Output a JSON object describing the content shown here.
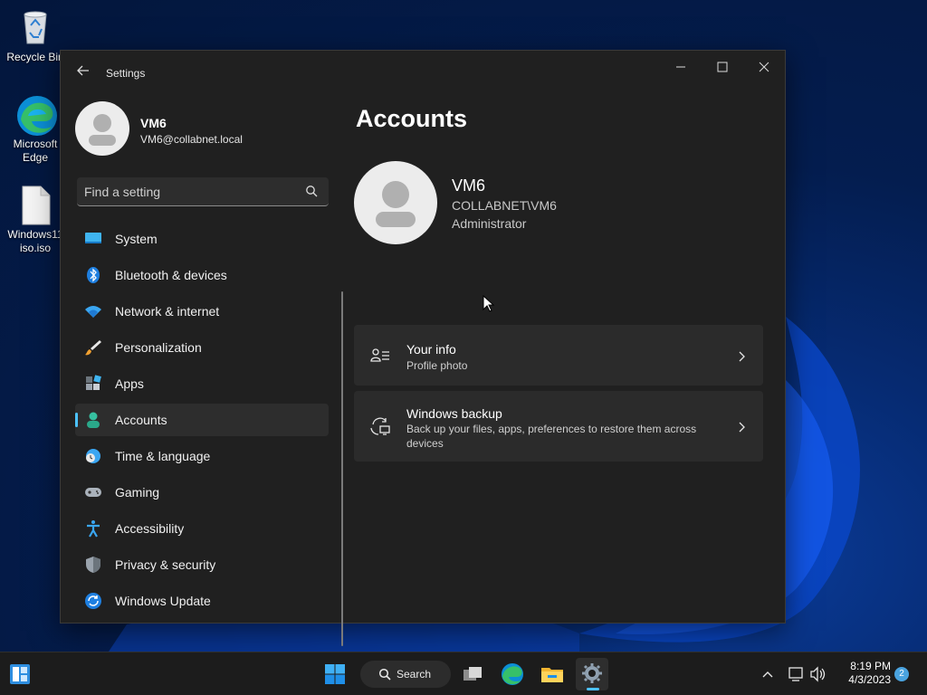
{
  "desktop": {
    "icons": [
      {
        "label": "Recycle Bin"
      },
      {
        "label": "Microsoft Edge"
      },
      {
        "label": "Windows11 iso.iso"
      }
    ]
  },
  "window": {
    "title": "Settings",
    "controls": {
      "minimize": "—",
      "maximize": "☐",
      "close": "✕"
    }
  },
  "profile": {
    "name": "VM6",
    "email": "VM6@collabnet.local"
  },
  "search": {
    "placeholder": "Find a setting"
  },
  "nav": {
    "items": [
      {
        "label": "System",
        "icon": "system-icon"
      },
      {
        "label": "Bluetooth & devices",
        "icon": "bluetooth-icon"
      },
      {
        "label": "Network & internet",
        "icon": "wifi-icon"
      },
      {
        "label": "Personalization",
        "icon": "brush-icon"
      },
      {
        "label": "Apps",
        "icon": "apps-icon"
      },
      {
        "label": "Accounts",
        "icon": "accounts-icon",
        "active": true
      },
      {
        "label": "Time & language",
        "icon": "time-language-icon"
      },
      {
        "label": "Gaming",
        "icon": "gamepad-icon"
      },
      {
        "label": "Accessibility",
        "icon": "accessibility-icon"
      },
      {
        "label": "Privacy & security",
        "icon": "shield-icon"
      },
      {
        "label": "Windows Update",
        "icon": "update-icon"
      }
    ]
  },
  "main": {
    "title": "Accounts",
    "account": {
      "name": "VM6",
      "domain": "COLLABNET\\VM6",
      "role": "Administrator"
    },
    "cards": [
      {
        "title": "Your info",
        "subtitle": "Profile photo",
        "icon": "person-info-icon"
      },
      {
        "title": "Windows backup",
        "subtitle": "Back up your files, apps, preferences to restore them across devices",
        "icon": "backup-icon"
      }
    ]
  },
  "taskbar": {
    "search_label": "Search",
    "clock": {
      "time": "8:19 PM",
      "date": "4/3/2023"
    },
    "notifications": "2"
  },
  "colors": {
    "accent": "#4cc2ff",
    "window_bg": "#202020",
    "card_bg": "#2b2b2b"
  }
}
